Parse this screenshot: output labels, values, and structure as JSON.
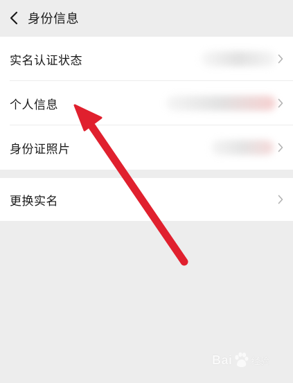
{
  "nav": {
    "title": "身份信息",
    "back_icon": "chevron-left-icon"
  },
  "sections": [
    {
      "items": [
        {
          "label": "实名认证状态",
          "value": "",
          "value_blurred": true,
          "has_chevron": true
        },
        {
          "label": "个人信息",
          "value": "",
          "value_blurred": true,
          "has_chevron": true
        },
        {
          "label": "身份证照片",
          "value": "",
          "value_blurred": true,
          "has_chevron": true
        }
      ]
    },
    {
      "items": [
        {
          "label": "更换实名",
          "has_chevron": true
        }
      ]
    }
  ],
  "annotation": {
    "type": "arrow",
    "color": "#e0202e",
    "points_to": "个人信息"
  },
  "watermark": {
    "brand": "Bai",
    "paw_icon": "baidu-paw-icon",
    "brand_suffix": "",
    "sub": "经验"
  },
  "colors": {
    "background": "#ededed",
    "cell_bg": "#ffffff",
    "text": "#1a1a1a",
    "chevron": "#b2b2b2",
    "arrow": "#e0202e"
  }
}
